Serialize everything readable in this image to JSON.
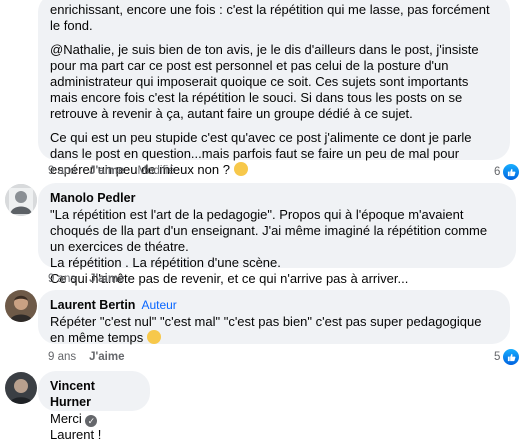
{
  "comments": [
    {
      "paragraphs": [
        "enrichissant, encore une fois : c'est la répétition qui me lasse, pas forcément le fond.",
        "@Nathalie, je suis bien de ton avis, je le dis d'ailleurs dans le post, j'insiste pour ma part car ce post est personnel et pas celui de la posture d'un administrateur qui imposerait quoique ce soit. Ces sujets sont importants mais encore fois c'est la répétition le souci. Si dans tous les posts on se retrouve à revenir à ça, autant faire un groupe dédié à ce sujet.",
        "Ce qui est un peu stupide c'est qu'avec ce post j'alimente ce dont je parle dans le post en question...mais parfois faut se faire un peu de mal pour espérer un peu de mieux non ?"
      ],
      "time": "9 ans",
      "like": "J'aime",
      "edited": "Modifié",
      "reaction_count": "6"
    },
    {
      "author": "Manolo Pedler",
      "lines": [
        "\"La répétition est l'art de la pedagogie\". Propos qui à l'époque m'avaient choqués de lla part d'un enseignant. J'ai même imaginé la répétition comme un exercices de théatre.",
        "La répétition . La répétition d'une scène.",
        "Ce qui n'arrête pas de revenir, et ce qui n'arrive pas à arriver..."
      ],
      "time": "9 ans",
      "like": "J'aime"
    },
    {
      "author": "Laurent Bertin",
      "author_tag": "Auteur",
      "text": "Répéter \"c'est nul\" \"c'est mal\" \"c'est pas bien\" c'est pas super pedagogique en même temps",
      "time": "9 ans",
      "like": "J'aime",
      "reaction_count": "5"
    },
    {
      "author": "Vincent Hurner",
      "text_before": "Merci",
      "text_after": "Laurent !"
    }
  ]
}
